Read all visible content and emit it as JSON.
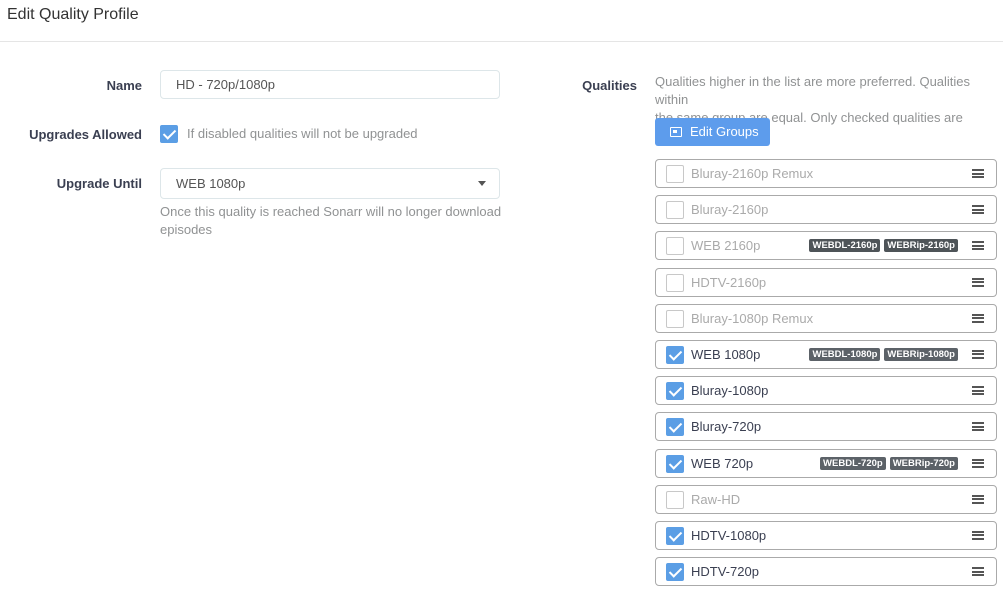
{
  "header": {
    "title": "Edit Quality Profile"
  },
  "form": {
    "name_label": "Name",
    "name_value": "HD - 720p/1080p",
    "upgrades_label": "Upgrades Allowed",
    "upgrades_checked": true,
    "upgrades_help": "If disabled qualities will not be upgraded",
    "upgrade_until_label": "Upgrade Until",
    "upgrade_until_value": "WEB 1080p",
    "upgrade_until_help_line1": "Once this quality is reached Sonarr will no longer download",
    "upgrade_until_help_line2": "episodes"
  },
  "qualities": {
    "label": "Qualities",
    "help_line1": "Qualities higher in the list are more preferred. Qualities within",
    "help_line2": "the same group are equal. Only checked qualities are wanted",
    "edit_groups_label": "Edit Groups",
    "items": [
      {
        "name": "Bluray-2160p Remux",
        "checked": false,
        "badges": []
      },
      {
        "name": "Bluray-2160p",
        "checked": false,
        "badges": []
      },
      {
        "name": "WEB 2160p",
        "checked": false,
        "badges": [
          "WEBDL-2160p",
          "WEBRip-2160p"
        ]
      },
      {
        "name": "HDTV-2160p",
        "checked": false,
        "badges": []
      },
      {
        "name": "Bluray-1080p Remux",
        "checked": false,
        "badges": []
      },
      {
        "name": "WEB 1080p",
        "checked": true,
        "badges": [
          "WEBDL-1080p",
          "WEBRip-1080p"
        ]
      },
      {
        "name": "Bluray-1080p",
        "checked": true,
        "badges": []
      },
      {
        "name": "Bluray-720p",
        "checked": true,
        "badges": []
      },
      {
        "name": "WEB 720p",
        "checked": true,
        "badges": [
          "WEBDL-720p",
          "WEBRip-720p"
        ]
      },
      {
        "name": "Raw-HD",
        "checked": false,
        "badges": []
      },
      {
        "name": "HDTV-1080p",
        "checked": true,
        "badges": []
      },
      {
        "name": "HDTV-720p",
        "checked": true,
        "badges": []
      }
    ]
  }
}
